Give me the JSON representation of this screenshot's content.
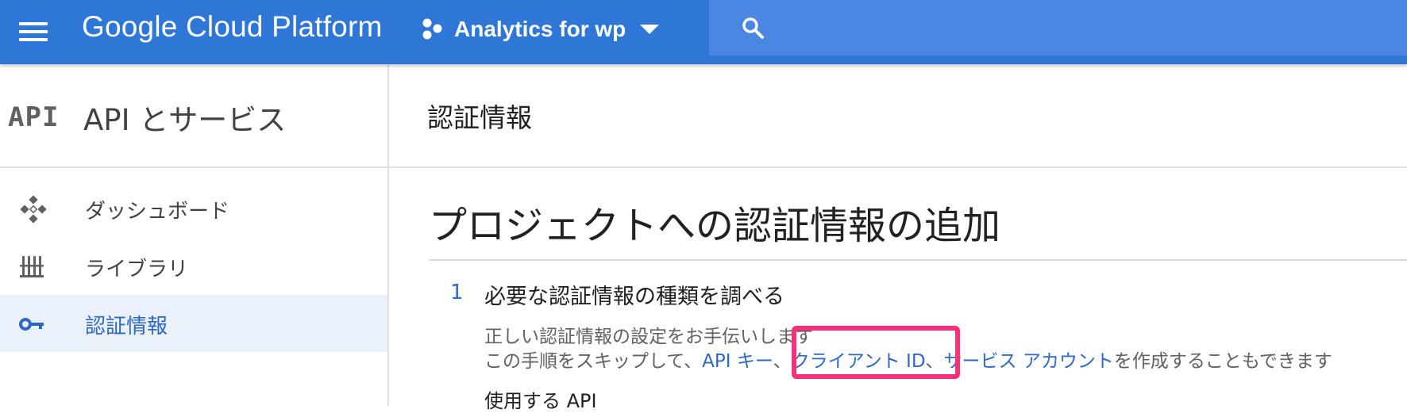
{
  "topbar": {
    "brand": "Google Cloud Platform",
    "project_name": "Analytics for wp"
  },
  "sidebar": {
    "logo_text": "API",
    "title": "API とサービス",
    "items": [
      {
        "label": "ダッシュボード",
        "icon": "dashboard-icon",
        "active": false
      },
      {
        "label": "ライブラリ",
        "icon": "library-icon",
        "active": false
      },
      {
        "label": "認証情報",
        "icon": "key-icon",
        "active": true
      }
    ]
  },
  "main": {
    "page_title": "認証情報",
    "heading": "プロジェクトへの認証情報の追加",
    "step": {
      "number": "1",
      "title": "必要な認証情報の種類を調べる",
      "line1": "正しい認証情報の設定をお手伝いします",
      "line2_prefix": "この手順をスキップして、",
      "link_api_key": "API キー",
      "sep1": "、",
      "link_client_id": "クライアント ID",
      "sep2": "、",
      "link_service_account": "サービス アカウント",
      "line2_suffix": "を作成することもできます"
    },
    "subheading": "使用する API"
  },
  "colors": {
    "topbar": "#2e77d7",
    "search_bar": "#4a86e2",
    "link": "#2e68c6",
    "active_bg": "#eaf1fb",
    "highlight": "#ff2e7a"
  }
}
